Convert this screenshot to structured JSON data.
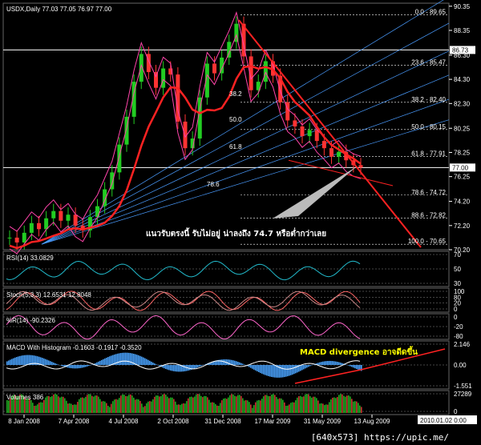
{
  "chart_data": [
    {
      "type": "candlestick",
      "symbol_header": "USDX,Daily  77.03 77.05 76.97 77.00",
      "ylim": [
        70.2,
        90.6
      ],
      "x_ticks": [
        "8 Jan 2008",
        "7 Apr 2008",
        "4 Jul 2008",
        "2 Oct 2008",
        "31 Dec 2008",
        "17 Mar 2009",
        "31 May 2009",
        "13 Aug 2009"
      ],
      "y_ticks": [
        "90.35",
        "88.35",
        "86.30",
        "84.30",
        "82.30",
        "80.25",
        "78.25",
        "76.25",
        "74.20",
        "72.20",
        "70.20"
      ],
      "price_flags": [
        {
          "label": "86.73",
          "value": 86.73
        },
        {
          "label": "77.00",
          "value": 77.0
        }
      ],
      "fib_levels": [
        {
          "label": "0.0 - 89.65",
          "value": 89.65
        },
        {
          "label": "23.6 - 85.47",
          "value": 85.47
        },
        {
          "label": "38.2 - 82.40",
          "value": 82.4
        },
        {
          "label": "50.0 - 80.15",
          "value": 80.15
        },
        {
          "label": "61.8 - 77.91",
          "value": 77.91
        },
        {
          "label": "78.6 - 74.72",
          "value": 74.72
        },
        {
          "label": "88.6 - 72.82",
          "value": 72.82
        },
        {
          "label": "100.0 - 70.65",
          "value": 70.65
        }
      ],
      "fan_labels": [
        "38.2",
        "50.0",
        "61.8",
        "78.6"
      ],
      "close_series": [
        71.2,
        70.8,
        71.6,
        72.4,
        71.9,
        72.8,
        73.4,
        72.6,
        73.1,
        72.2,
        71.8,
        72.9,
        73.8,
        75.2,
        76.6,
        78.9,
        81.2,
        84.1,
        86.4,
        84.9,
        83.6,
        85.2,
        84.7,
        80.8,
        78.6,
        79.4,
        82.8,
        85.6,
        84.8,
        86.1,
        87.4,
        88.9,
        86.2,
        83.4,
        84.1,
        85.8,
        84.6,
        82.4,
        80.9,
        80.4,
        79.6,
        80.1,
        79.2,
        78.6,
        77.9,
        78.3,
        77.6,
        77.2,
        77.0
      ],
      "annotation": "แนวรับตรงนี้ รับไม่อยู่ น่าลงถึง 74.7 หรือต่ำกว่าเลย"
    },
    {
      "type": "line",
      "title": "RSI(14) 33.0829",
      "levels": [
        "70",
        "50",
        "30"
      ]
    },
    {
      "type": "line",
      "title": "Stoch(5,3,3) 12.6531 12.8048",
      "levels": [
        "100",
        "80",
        "20",
        "0"
      ]
    },
    {
      "type": "line",
      "title": "%R(14) -90.2326",
      "levels": [
        "0",
        "-20",
        "-80"
      ]
    },
    {
      "type": "bar",
      "title": "MACD With Histogram -0.1603 -0.1917 -0.3520",
      "levels": [
        "2.146",
        "0.00",
        "-1.551"
      ],
      "annotation": "MACD divergence อาจดีดขึ้น"
    },
    {
      "type": "bar",
      "title": "Volumes 386",
      "levels": [
        "27289",
        "0"
      ]
    }
  ],
  "status": {
    "timestamp": "2010.01.02 0:00",
    "footer": "[640x573] https://upic.me/"
  },
  "colors": {
    "bull": "#22cc22",
    "bear": "#ff3333",
    "fib": "#ffffff",
    "fan": "#4a9cff",
    "envelope": "#ff44aa",
    "ma": "#ff2222",
    "macd_hist": "#4aa3ff",
    "volume": "#22aa22",
    "annotation_thai": "#ffffff",
    "annotation_macd": "#ffff00"
  }
}
